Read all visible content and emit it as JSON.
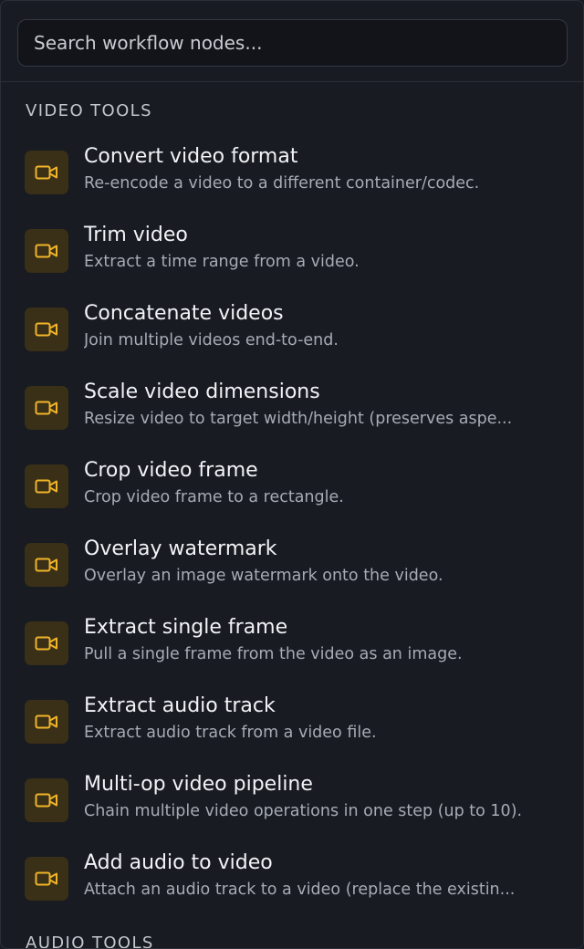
{
  "search": {
    "placeholder": "Search workflow nodes..."
  },
  "sections": [
    {
      "heading": "VIDEO TOOLS",
      "items": [
        {
          "title": "Convert video format",
          "description": "Re-encode a video to a different container/codec.",
          "icon": "video-camera-icon"
        },
        {
          "title": "Trim video",
          "description": "Extract a time range from a video.",
          "icon": "video-camera-icon"
        },
        {
          "title": "Concatenate videos",
          "description": "Join multiple videos end-to-end.",
          "icon": "video-camera-icon"
        },
        {
          "title": "Scale video dimensions",
          "description": "Resize video to target width/height (preserves aspe...",
          "icon": "video-camera-icon"
        },
        {
          "title": "Crop video frame",
          "description": "Crop video frame to a rectangle.",
          "icon": "video-camera-icon"
        },
        {
          "title": "Overlay watermark",
          "description": "Overlay an image watermark onto the video.",
          "icon": "video-camera-icon"
        },
        {
          "title": "Extract single frame",
          "description": "Pull a single frame from the video as an image.",
          "icon": "video-camera-icon"
        },
        {
          "title": "Extract audio track",
          "description": "Extract audio track from a video file.",
          "icon": "video-camera-icon"
        },
        {
          "title": "Multi-op video pipeline",
          "description": "Chain multiple video operations in one step (up to 10).",
          "icon": "video-camera-icon"
        },
        {
          "title": "Add audio to video",
          "description": "Attach an audio track to a video (replace the existin...",
          "icon": "video-camera-icon"
        }
      ]
    },
    {
      "heading": "AUDIO TOOLS",
      "items": []
    }
  ],
  "colors": {
    "background": "#181b22",
    "icon_accent": "#f0b429",
    "icon_background": "#3a2f17"
  }
}
